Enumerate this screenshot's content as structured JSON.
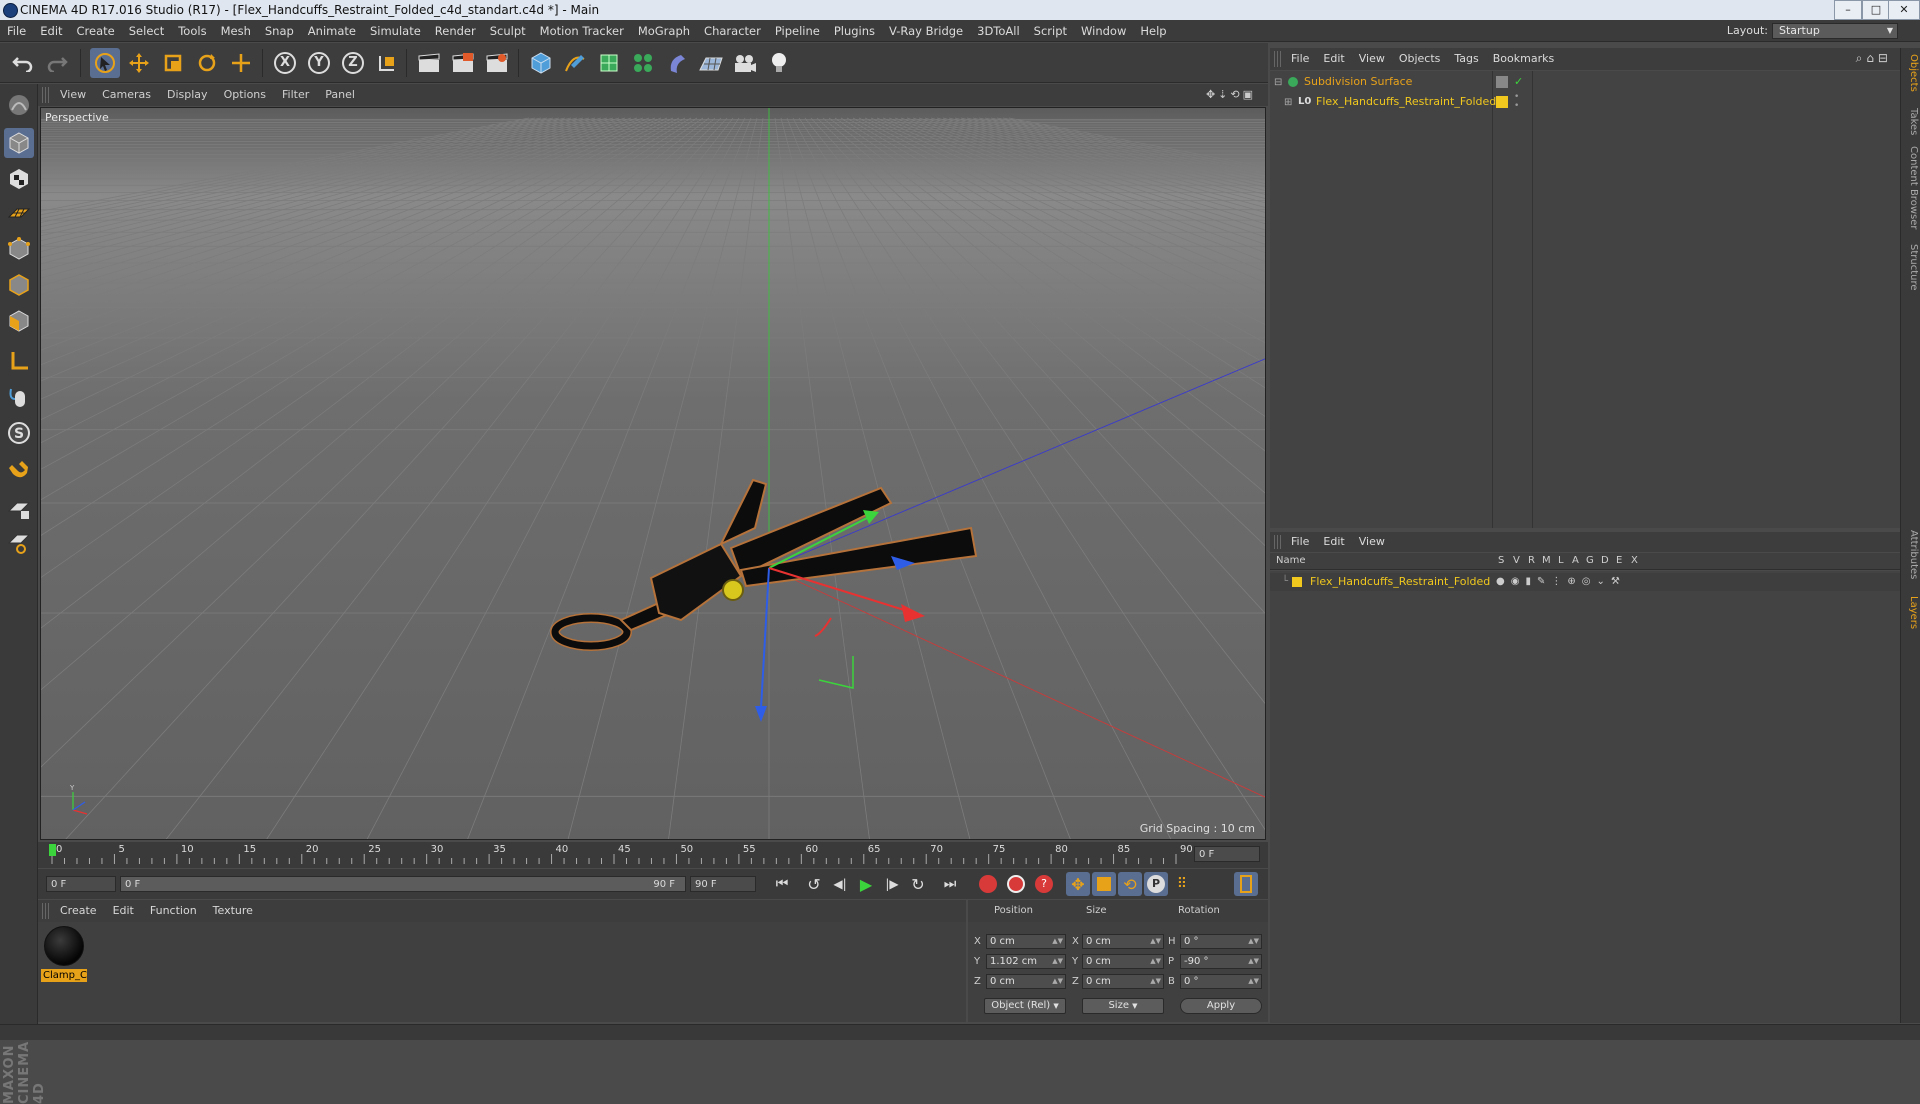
{
  "window": {
    "title": "CINEMA 4D R17.016 Studio (R17) - [Flex_Handcuffs_Restraint_Folded_c4d_standart.c4d *] - Main",
    "controls": [
      "–",
      "□",
      "✕"
    ]
  },
  "menubar": {
    "items": [
      "File",
      "Edit",
      "Create",
      "Select",
      "Tools",
      "Mesh",
      "Snap",
      "Animate",
      "Simulate",
      "Render",
      "Sculpt",
      "Motion Tracker",
      "MoGraph",
      "Character",
      "Pipeline",
      "Plugins",
      "V-Ray Bridge",
      "3DToAll",
      "Script",
      "Window",
      "Help"
    ],
    "layout_label": "Layout:",
    "layout_value": "Startup"
  },
  "toolbar": {
    "axis_labels": [
      "X",
      "Y",
      "Z"
    ]
  },
  "viewport": {
    "menu": [
      "View",
      "Cameras",
      "Display",
      "Options",
      "Filter",
      "Panel"
    ],
    "label": "Perspective",
    "grid_spacing": "Grid Spacing : 10 cm"
  },
  "timeline": {
    "ticks": [
      "0",
      "5",
      "10",
      "15",
      "20",
      "25",
      "30",
      "35",
      "40",
      "45",
      "50",
      "55",
      "60",
      "65",
      "70",
      "75",
      "80",
      "85",
      "90"
    ],
    "current_frame": "0 F",
    "start_field": "0 F",
    "range_start": "0 F",
    "range_end": "90 F",
    "end_field": "90 F"
  },
  "material_manager": {
    "menu": [
      "Create",
      "Edit",
      "Function",
      "Texture"
    ],
    "materials": [
      {
        "label": "Clamp_C"
      }
    ]
  },
  "coordinates": {
    "headers": [
      "Position",
      "Size",
      "Rotation"
    ],
    "rows": [
      {
        "axis": "X",
        "pos": "0 cm",
        "size_axis": "X",
        "size": "0 cm",
        "rot_axis": "H",
        "rot": "0 °"
      },
      {
        "axis": "Y",
        "pos": "1.102 cm",
        "size_axis": "Y",
        "size": "0 cm",
        "rot_axis": "P",
        "rot": "-90 °"
      },
      {
        "axis": "Z",
        "pos": "0 cm",
        "size_axis": "Z",
        "size": "0 cm",
        "rot_axis": "B",
        "rot": "0 °"
      }
    ],
    "mode": "Object (Rel)",
    "size_mode": "Size",
    "apply": "Apply"
  },
  "object_manager": {
    "menu": [
      "File",
      "Edit",
      "View",
      "Objects",
      "Tags",
      "Bookmarks"
    ],
    "objects": [
      {
        "name": "Subdivision Surface",
        "color": "#e8a21a"
      },
      {
        "name": "Flex_Handcuffs_Restraint_Folded",
        "color": "#f0c81e"
      }
    ]
  },
  "layer_manager": {
    "menu": [
      "File",
      "Edit",
      "View"
    ],
    "columns": [
      "Name",
      "S",
      "V",
      "R",
      "M",
      "L",
      "A",
      "G",
      "D",
      "E",
      "X"
    ],
    "layers": [
      {
        "name": "Flex_Handcuffs_Restraint_Folded",
        "color": "#f0c81e"
      }
    ]
  },
  "side_tabs": [
    "Objects",
    "Takes",
    "Content Browser",
    "Structure",
    "Attributes",
    "Layers"
  ],
  "logo": {
    "text": "MAXON CINEMA 4D"
  },
  "colors": {
    "accent_blue": "#5a6e92",
    "highlight_orange": "#e8a21a",
    "object_yellow": "#f0c81e"
  }
}
